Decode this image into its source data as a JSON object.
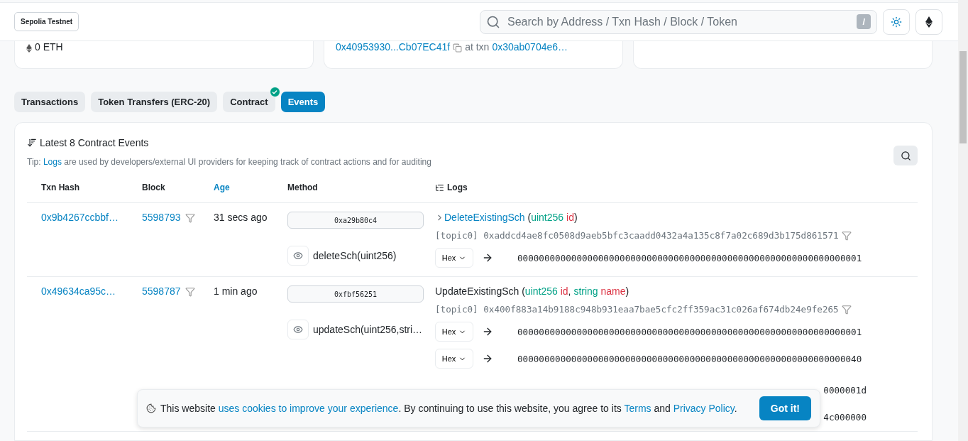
{
  "header": {
    "network": "Sepolia Testnet",
    "search": {
      "placeholder": "Search by Address / Txn Hash / Block / Token",
      "shortcut": "/"
    }
  },
  "summary_cards": [
    {
      "kind": "balance",
      "value": "0 ETH"
    },
    {
      "kind": "creator",
      "address": "0x40953930...Cb07EC41f",
      "at": "at txn",
      "txn": "0x30ab0704e6…"
    },
    {
      "kind": "empty"
    }
  ],
  "tabs": [
    {
      "label": "Transactions",
      "selected": false,
      "verified": false
    },
    {
      "label": "Token Transfers (ERC-20)",
      "selected": false,
      "verified": false
    },
    {
      "label": "Contract",
      "selected": false,
      "verified": true
    },
    {
      "label": "Events",
      "selected": true,
      "verified": false
    }
  ],
  "events": {
    "title": "Latest 8 Contract Events",
    "tip": [
      {
        "text": "Tip: ",
        "link": false
      },
      {
        "text": "Logs",
        "link": true
      },
      {
        "text": " are used by developers/external UI providers for keeping track of contract actions and for auditing",
        "link": false
      }
    ],
    "columns": [
      {
        "label": "Txn Hash",
        "sortable": false
      },
      {
        "label": "Block",
        "sortable": false
      },
      {
        "label": "Age",
        "sortable": true
      },
      {
        "label": "Method",
        "sortable": false
      },
      {
        "label": "Logs",
        "sortable": false
      }
    ],
    "rows": [
      {
        "txn_hash": "0x9b4267ccbbf…",
        "block": "5598793",
        "age": "31 secs ago",
        "selector": "0xa29b80c4",
        "method": "deleteSch(uint256)",
        "event": {
          "linked": true,
          "name": "DeleteExistingSch",
          "signature": [
            {
              "kind": "punct",
              "text": " ("
            },
            {
              "kind": "type",
              "text": "uint256"
            },
            {
              "kind": "param",
              "text": " id"
            },
            {
              "kind": "punct",
              "text": ")"
            }
          ]
        },
        "topic": "[topic0] 0xaddcd4ae8fc0508d9aeb5bfc3caadd0432a4a135c8f7a02c689d3b175d861571",
        "data": [
          {
            "format": "Hex",
            "value": "0000000000000000000000000000000000000000000000000000000000000001"
          }
        ]
      },
      {
        "txn_hash": "0x49634ca95c…",
        "block": "5598787",
        "age": "1 min ago",
        "selector": "0xfbf56251",
        "method": "updateSch(uint256,stri…",
        "event": {
          "linked": false,
          "name": "UpdateExistingSch",
          "signature": [
            {
              "kind": "punct",
              "text": " ("
            },
            {
              "kind": "type",
              "text": "uint256"
            },
            {
              "kind": "param",
              "text": " id"
            },
            {
              "kind": "punct",
              "text": ", "
            },
            {
              "kind": "type",
              "text": "string"
            },
            {
              "kind": "param",
              "text": " name"
            },
            {
              "kind": "punct",
              "text": ")"
            }
          ]
        },
        "topic": "[topic0] 0x400f883a14b9188c948b931eaa7bae5cfc2ff359ac31c026af674db24e9fe265",
        "data": [
          {
            "format": "Hex",
            "value": "0000000000000000000000000000000000000000000000000000000000000001"
          },
          {
            "format": "Hex",
            "value": "0000000000000000000000000000000000000000000000000000000000000040"
          },
          {
            "value": "0000001d"
          },
          {
            "value": "4c000000"
          }
        ]
      }
    ]
  },
  "cookie_banner": {
    "text": [
      {
        "text": "This website ",
        "link": false
      },
      {
        "text": "uses cookies to improve your experience",
        "link": true
      },
      {
        "text": ". By continuing to use this website, you agree to its ",
        "link": false
      },
      {
        "text": "Terms",
        "link": true
      },
      {
        "text": " and ",
        "link": false
      },
      {
        "text": "Privacy Policy",
        "link": true
      },
      {
        "text": ".",
        "link": false
      }
    ],
    "button": "Got it!"
  }
}
